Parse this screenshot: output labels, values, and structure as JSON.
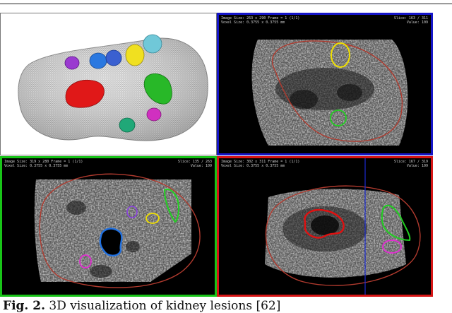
{
  "figure": {
    "caption_label": "Fig. 2.",
    "caption_text": "3D visualization of kidney lesions [62]",
    "panels": {
      "top_right": {
        "header_left_1": "Image Size: 263 x 290  Frame = 1 (1/1)",
        "header_left_2": "Voxel Size: 0.3755 x 0.3755 mm",
        "header_right_1": "Slice: 163 / 311",
        "header_right_2": "Value: 109"
      },
      "bottom_left": {
        "header_left_1": "Image Size: 319 x 280  Frame = 1 (1/1)",
        "header_left_2": "Voxel Size: 0.3755 x 0.3755 mm",
        "header_right_1": "Slice: 135 / 263",
        "header_right_2": "Value: 109"
      },
      "bottom_right": {
        "header_left_1": "Image Size: 302 x 311  Frame = 1 (1/1)",
        "header_left_2": "Voxel Size: 0.3755 x 0.3755 mm",
        "header_right_1": "Slice: 167 / 319",
        "header_right_2": "Value: 109"
      }
    },
    "colors": {
      "border_axial": "#1515c8",
      "border_sagittal": "#18c418",
      "border_coronal": "#d61515",
      "kidney_contour": "#b03a2e",
      "lesion_red": "#e01010",
      "lesion_green": "#22d022",
      "lesion_yellow": "#f0e000",
      "lesion_blue": "#2070e0",
      "lesion_magenta": "#d020c0",
      "lesion_cyan": "#50b8c8",
      "lesion_teal": "#18a070",
      "lesion_violet": "#8a30c8"
    }
  }
}
